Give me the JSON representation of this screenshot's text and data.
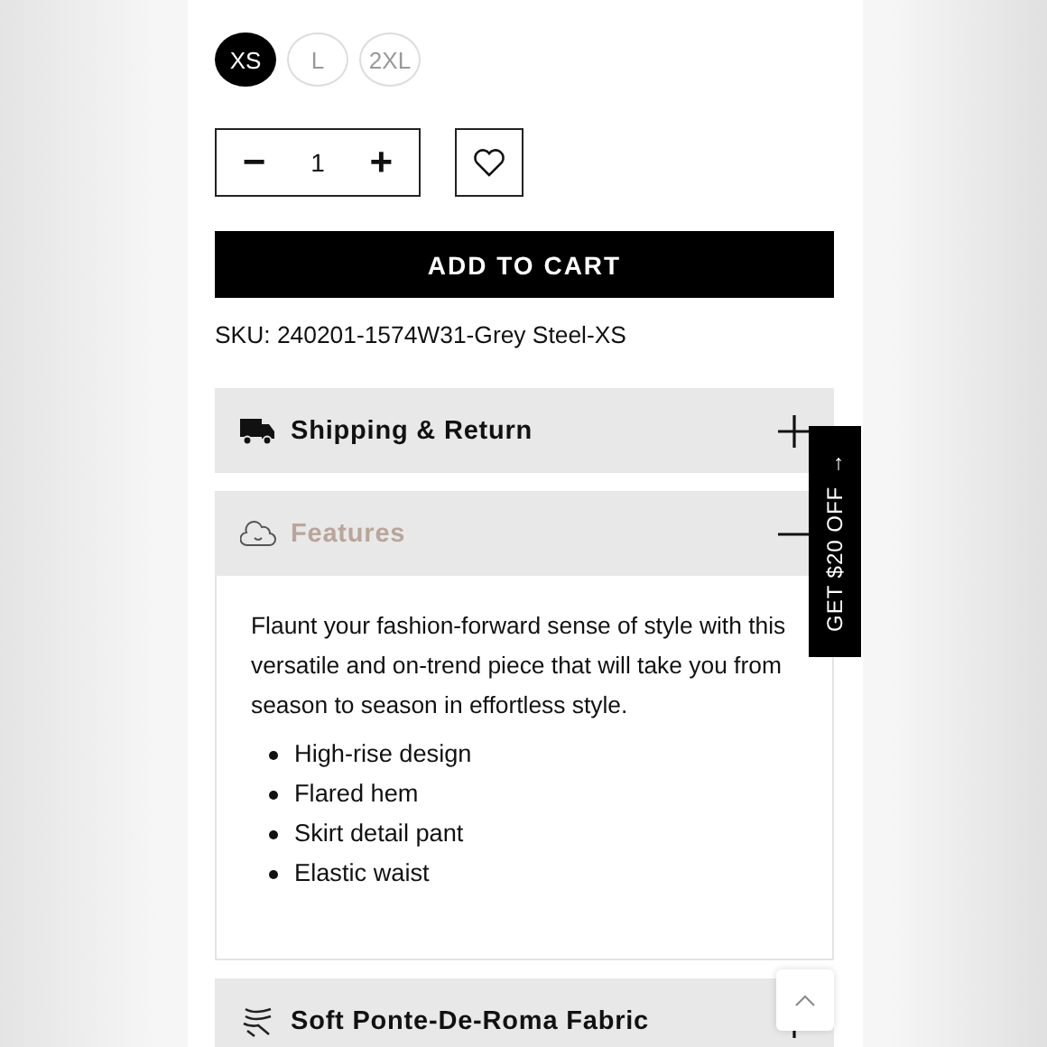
{
  "sizes": [
    {
      "label": "XS",
      "selected": true
    },
    {
      "label": "L",
      "selected": false
    },
    {
      "label": "2XL",
      "selected": false
    }
  ],
  "quantity": {
    "decrease": "−",
    "value": "1",
    "increase": "+"
  },
  "add_to_cart": "ADD TO CART",
  "sku": "SKU: 240201-1574W31-Grey Steel-XS",
  "accordion": [
    {
      "kind": "truck",
      "title": "Shipping & Return",
      "expanded": false
    },
    {
      "kind": "cloud",
      "title": "Features",
      "expanded": true,
      "description": "Flaunt your fashion-forward sense of style with this versatile and on-trend piece that will take you from season to season in effortless style.",
      "bullets": [
        "High-rise design",
        "Flared hem",
        "Skirt detail pant",
        "Elastic waist"
      ]
    },
    {
      "kind": "fabric",
      "title": "Soft Ponte-De-Roma Fabric",
      "expanded": false
    }
  ],
  "promo_tab": {
    "label": "GET $20 OFF",
    "arrow": "→"
  }
}
